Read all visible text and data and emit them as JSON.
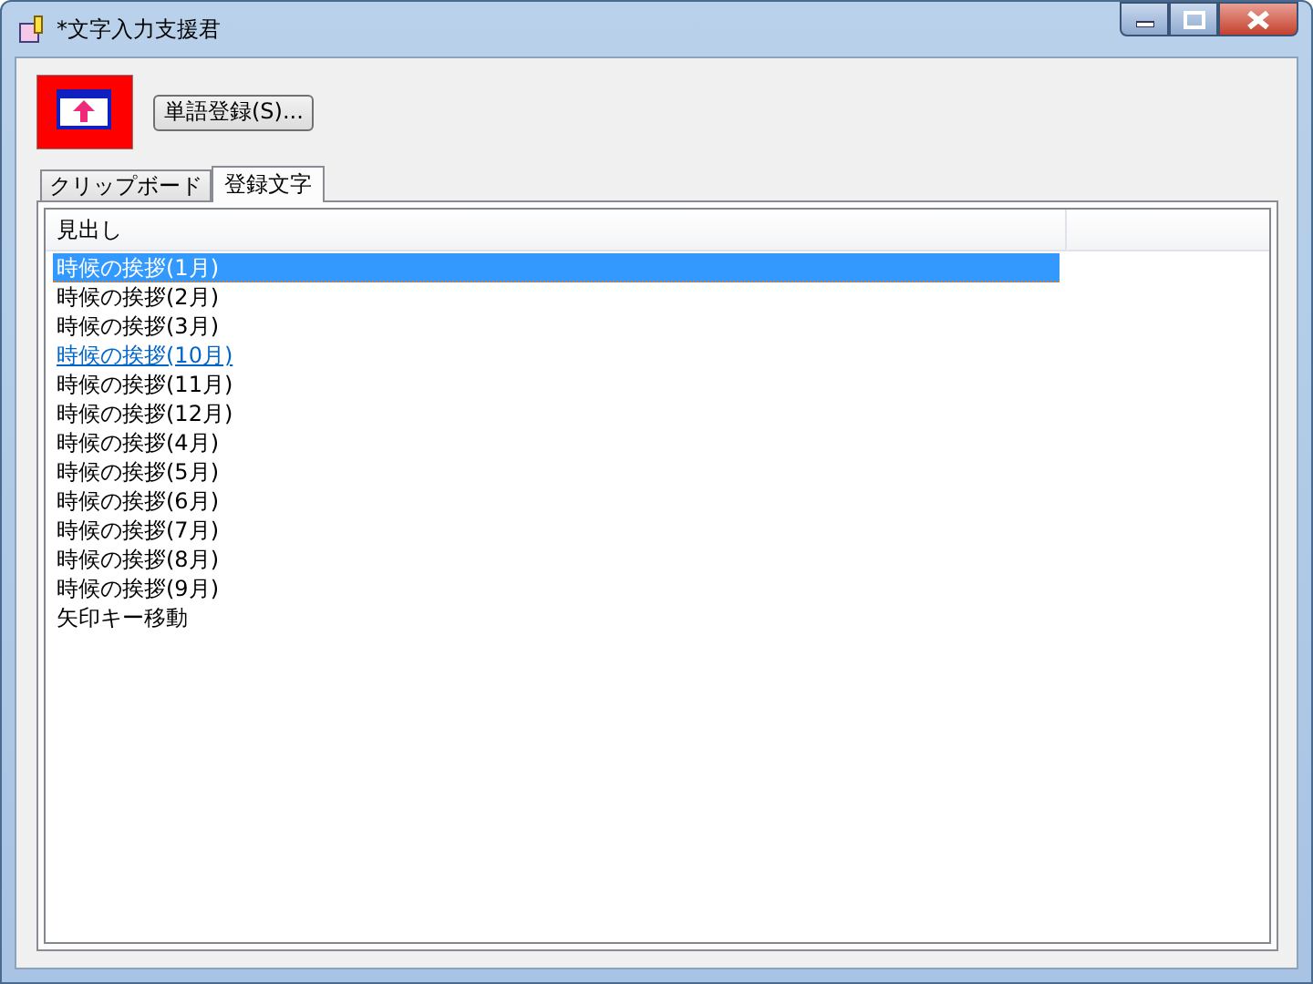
{
  "window": {
    "title": "*文字入力支援君"
  },
  "toolbar": {
    "button": "単語登録(S)..."
  },
  "tabs": [
    {
      "label": "クリップボード",
      "selected": false
    },
    {
      "label": "登録文字",
      "selected": true
    }
  ],
  "list": {
    "columns": [
      "見出し"
    ],
    "rows": [
      {
        "text": "時候の挨拶(1月)",
        "selected": true,
        "hovered": false
      },
      {
        "text": "時候の挨拶(2月)",
        "selected": false,
        "hovered": false
      },
      {
        "text": "時候の挨拶(3月)",
        "selected": false,
        "hovered": false
      },
      {
        "text": "時候の挨拶(10月)",
        "selected": false,
        "hovered": true
      },
      {
        "text": "時候の挨拶(11月)",
        "selected": false,
        "hovered": false
      },
      {
        "text": "時候の挨拶(12月)",
        "selected": false,
        "hovered": false
      },
      {
        "text": "時候の挨拶(4月)",
        "selected": false,
        "hovered": false
      },
      {
        "text": "時候の挨拶(5月)",
        "selected": false,
        "hovered": false
      },
      {
        "text": "時候の挨拶(6月)",
        "selected": false,
        "hovered": false
      },
      {
        "text": "時候の挨拶(7月)",
        "selected": false,
        "hovered": false
      },
      {
        "text": "時候の挨拶(8月)",
        "selected": false,
        "hovered": false
      },
      {
        "text": "時候の挨拶(9月)",
        "selected": false,
        "hovered": false
      },
      {
        "text": "矢印キー移動",
        "selected": false,
        "hovered": false
      }
    ]
  }
}
